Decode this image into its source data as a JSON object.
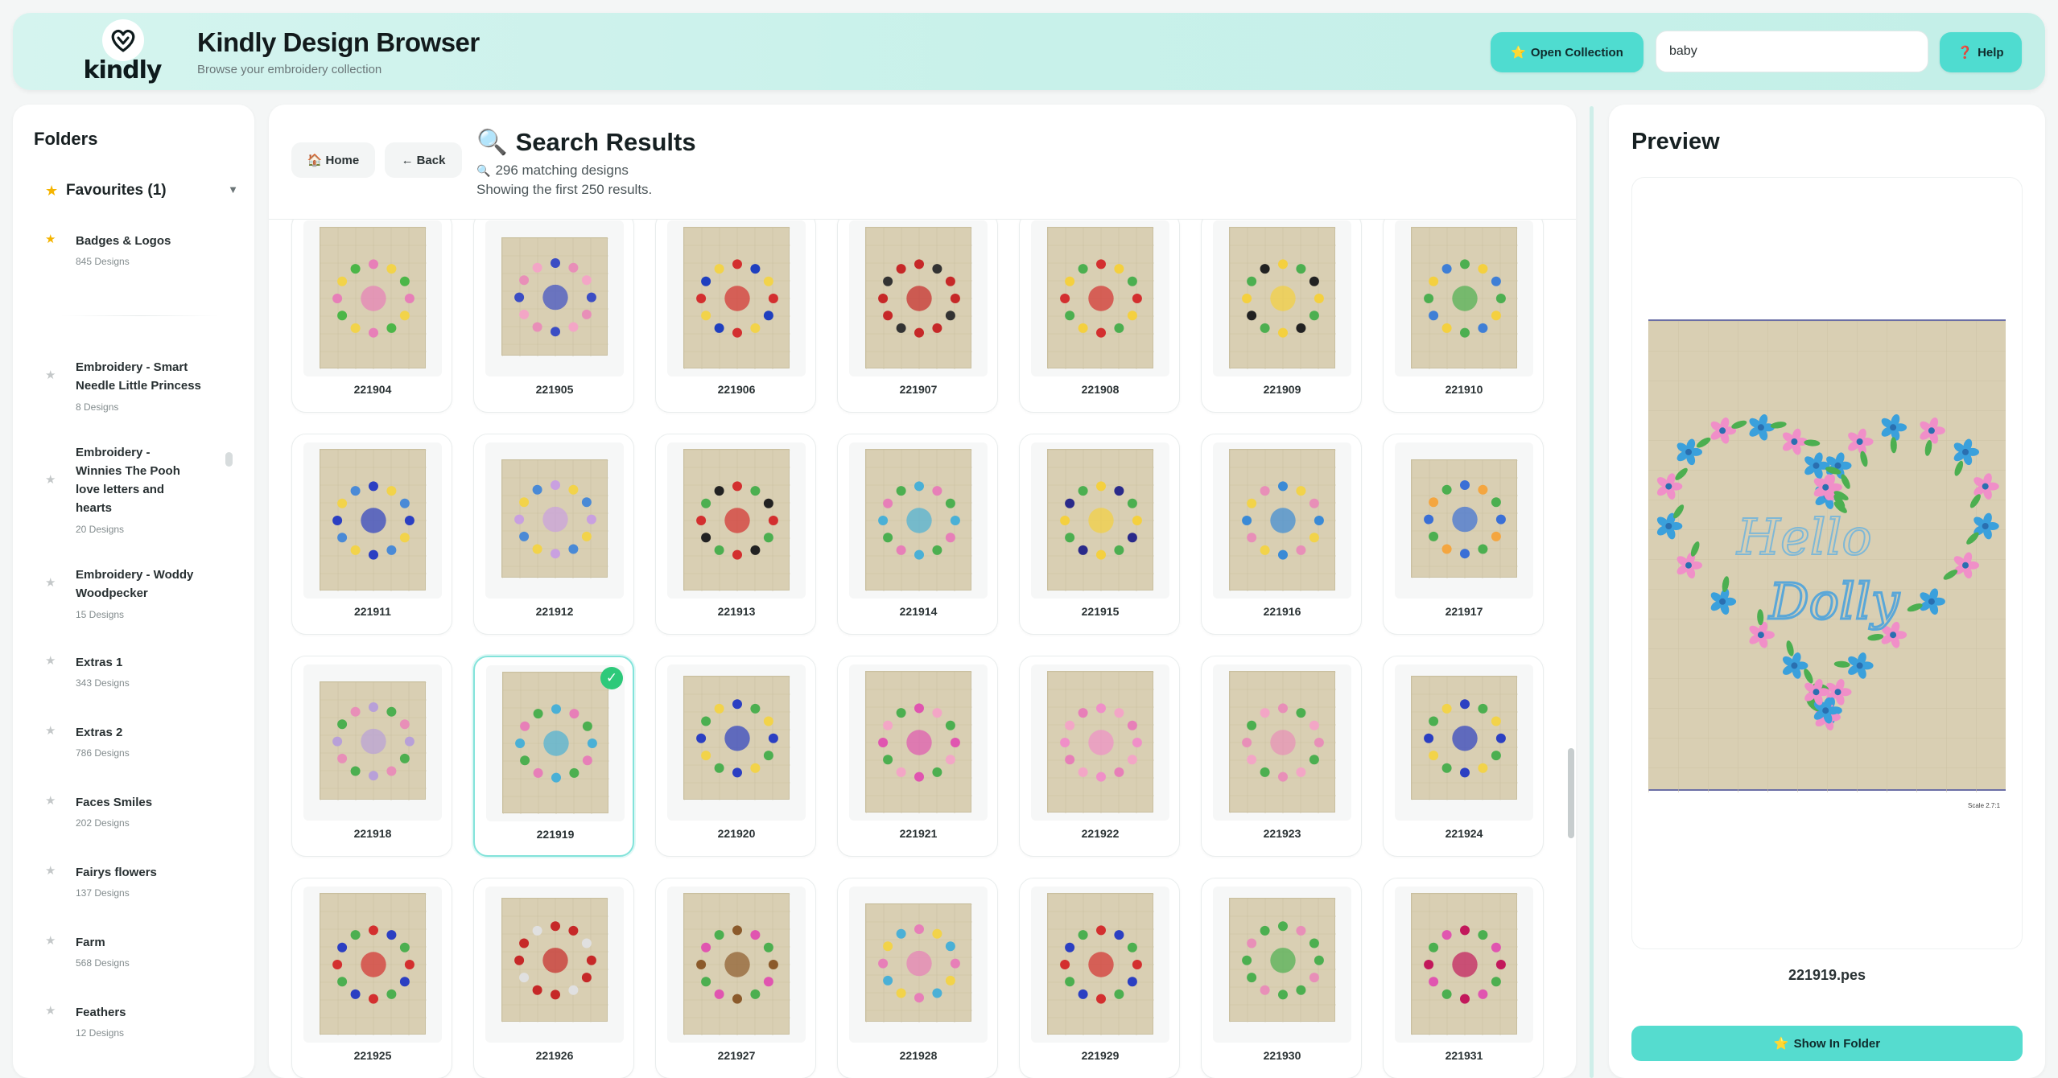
{
  "header": {
    "logo_text": "kindly",
    "title": "Kindly Design Browser",
    "subtitle": "Browse your embroidery collection",
    "open_collection_label": "Open Collection",
    "open_collection_icon": "⭐",
    "search_value": "baby",
    "help_label": "Help",
    "help_icon": "❓"
  },
  "folders": {
    "title": "Folders",
    "favourites_label": "Favourites (1)",
    "favourite_items": [
      {
        "name": "Badges & Logos",
        "count": "845 Designs"
      }
    ],
    "items": [
      {
        "name": "Embroidery - Smart Needle Little Princess",
        "count": "8 Designs"
      },
      {
        "name": "Embroidery - Winnies The Pooh love letters and hearts",
        "count": "20 Designs"
      },
      {
        "name": "Embroidery - Woddy Woodpecker",
        "count": "15 Designs"
      },
      {
        "name": "Extras 1",
        "count": "343 Designs"
      },
      {
        "name": "Extras 2",
        "count": "786 Designs"
      },
      {
        "name": "Faces Smiles",
        "count": "202 Designs"
      },
      {
        "name": "Fairys flowers",
        "count": "137 Designs"
      },
      {
        "name": "Farm",
        "count": "568 Designs"
      },
      {
        "name": "Feathers",
        "count": "12 Designs"
      }
    ]
  },
  "main": {
    "home_label": "Home",
    "back_label": "Back",
    "title": "Search Results",
    "match_count": "296 matching designs",
    "showing": "Showing the first 250 results.",
    "selected_design": "221919",
    "designs": [
      "221904",
      "221905",
      "221906",
      "221907",
      "221908",
      "221909",
      "221910",
      "221911",
      "221912",
      "221913",
      "221914",
      "221915",
      "221916",
      "221917",
      "221918",
      "221919",
      "221920",
      "221921",
      "221922",
      "221923",
      "221924",
      "221925",
      "221926",
      "221927",
      "221928",
      "221929",
      "221930",
      "221931"
    ]
  },
  "preview": {
    "title": "Preview",
    "scale_label": "Scale 2.7:1",
    "file_name": "221919.pes",
    "show_in_folder_label": "Show In Folder",
    "show_in_folder_icon": "⭐"
  },
  "colors": {
    "accent": "#4fdcd0",
    "header_bg": "#c8f1ea",
    "fabric": "#d9cfb3",
    "selected_border": "#83e3da",
    "check": "#2ec97a",
    "star": "#f5b400"
  }
}
